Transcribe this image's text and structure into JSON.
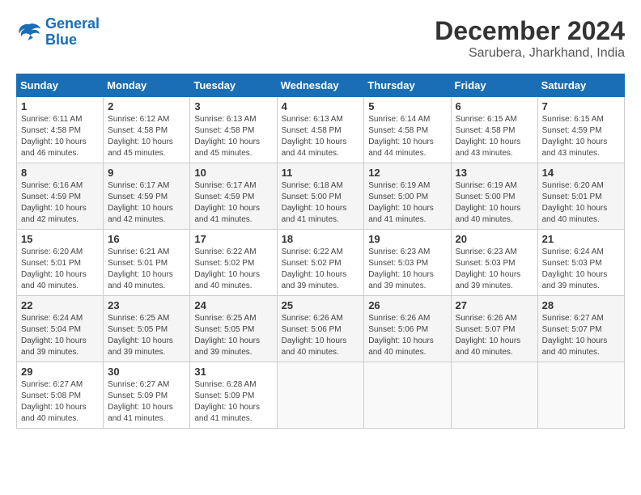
{
  "header": {
    "logo_line1": "General",
    "logo_line2": "Blue",
    "title": "December 2024",
    "location": "Sarubera, Jharkhand, India"
  },
  "calendar": {
    "days_of_week": [
      "Sunday",
      "Monday",
      "Tuesday",
      "Wednesday",
      "Thursday",
      "Friday",
      "Saturday"
    ],
    "weeks": [
      [
        {
          "day": "",
          "info": ""
        },
        {
          "day": "2",
          "info": "Sunrise: 6:12 AM\nSunset: 4:58 PM\nDaylight: 10 hours\nand 45 minutes."
        },
        {
          "day": "3",
          "info": "Sunrise: 6:13 AM\nSunset: 4:58 PM\nDaylight: 10 hours\nand 45 minutes."
        },
        {
          "day": "4",
          "info": "Sunrise: 6:13 AM\nSunset: 4:58 PM\nDaylight: 10 hours\nand 44 minutes."
        },
        {
          "day": "5",
          "info": "Sunrise: 6:14 AM\nSunset: 4:58 PM\nDaylight: 10 hours\nand 44 minutes."
        },
        {
          "day": "6",
          "info": "Sunrise: 6:15 AM\nSunset: 4:58 PM\nDaylight: 10 hours\nand 43 minutes."
        },
        {
          "day": "7",
          "info": "Sunrise: 6:15 AM\nSunset: 4:59 PM\nDaylight: 10 hours\nand 43 minutes."
        }
      ],
      [
        {
          "day": "8",
          "info": "Sunrise: 6:16 AM\nSunset: 4:59 PM\nDaylight: 10 hours\nand 42 minutes."
        },
        {
          "day": "9",
          "info": "Sunrise: 6:17 AM\nSunset: 4:59 PM\nDaylight: 10 hours\nand 42 minutes."
        },
        {
          "day": "10",
          "info": "Sunrise: 6:17 AM\nSunset: 4:59 PM\nDaylight: 10 hours\nand 41 minutes."
        },
        {
          "day": "11",
          "info": "Sunrise: 6:18 AM\nSunset: 5:00 PM\nDaylight: 10 hours\nand 41 minutes."
        },
        {
          "day": "12",
          "info": "Sunrise: 6:19 AM\nSunset: 5:00 PM\nDaylight: 10 hours\nand 41 minutes."
        },
        {
          "day": "13",
          "info": "Sunrise: 6:19 AM\nSunset: 5:00 PM\nDaylight: 10 hours\nand 40 minutes."
        },
        {
          "day": "14",
          "info": "Sunrise: 6:20 AM\nSunset: 5:01 PM\nDaylight: 10 hours\nand 40 minutes."
        }
      ],
      [
        {
          "day": "15",
          "info": "Sunrise: 6:20 AM\nSunset: 5:01 PM\nDaylight: 10 hours\nand 40 minutes."
        },
        {
          "day": "16",
          "info": "Sunrise: 6:21 AM\nSunset: 5:01 PM\nDaylight: 10 hours\nand 40 minutes."
        },
        {
          "day": "17",
          "info": "Sunrise: 6:22 AM\nSunset: 5:02 PM\nDaylight: 10 hours\nand 40 minutes."
        },
        {
          "day": "18",
          "info": "Sunrise: 6:22 AM\nSunset: 5:02 PM\nDaylight: 10 hours\nand 39 minutes."
        },
        {
          "day": "19",
          "info": "Sunrise: 6:23 AM\nSunset: 5:03 PM\nDaylight: 10 hours\nand 39 minutes."
        },
        {
          "day": "20",
          "info": "Sunrise: 6:23 AM\nSunset: 5:03 PM\nDaylight: 10 hours\nand 39 minutes."
        },
        {
          "day": "21",
          "info": "Sunrise: 6:24 AM\nSunset: 5:03 PM\nDaylight: 10 hours\nand 39 minutes."
        }
      ],
      [
        {
          "day": "22",
          "info": "Sunrise: 6:24 AM\nSunset: 5:04 PM\nDaylight: 10 hours\nand 39 minutes."
        },
        {
          "day": "23",
          "info": "Sunrise: 6:25 AM\nSunset: 5:05 PM\nDaylight: 10 hours\nand 39 minutes."
        },
        {
          "day": "24",
          "info": "Sunrise: 6:25 AM\nSunset: 5:05 PM\nDaylight: 10 hours\nand 39 minutes."
        },
        {
          "day": "25",
          "info": "Sunrise: 6:26 AM\nSunset: 5:06 PM\nDaylight: 10 hours\nand 40 minutes."
        },
        {
          "day": "26",
          "info": "Sunrise: 6:26 AM\nSunset: 5:06 PM\nDaylight: 10 hours\nand 40 minutes."
        },
        {
          "day": "27",
          "info": "Sunrise: 6:26 AM\nSunset: 5:07 PM\nDaylight: 10 hours\nand 40 minutes."
        },
        {
          "day": "28",
          "info": "Sunrise: 6:27 AM\nSunset: 5:07 PM\nDaylight: 10 hours\nand 40 minutes."
        }
      ],
      [
        {
          "day": "29",
          "info": "Sunrise: 6:27 AM\nSunset: 5:08 PM\nDaylight: 10 hours\nand 40 minutes."
        },
        {
          "day": "30",
          "info": "Sunrise: 6:27 AM\nSunset: 5:09 PM\nDaylight: 10 hours\nand 41 minutes."
        },
        {
          "day": "31",
          "info": "Sunrise: 6:28 AM\nSunset: 5:09 PM\nDaylight: 10 hours\nand 41 minutes."
        },
        {
          "day": "",
          "info": ""
        },
        {
          "day": "",
          "info": ""
        },
        {
          "day": "",
          "info": ""
        },
        {
          "day": "",
          "info": ""
        }
      ]
    ],
    "first_day_num": "1",
    "first_day_info": "Sunrise: 6:11 AM\nSunset: 4:58 PM\nDaylight: 10 hours\nand 46 minutes."
  }
}
